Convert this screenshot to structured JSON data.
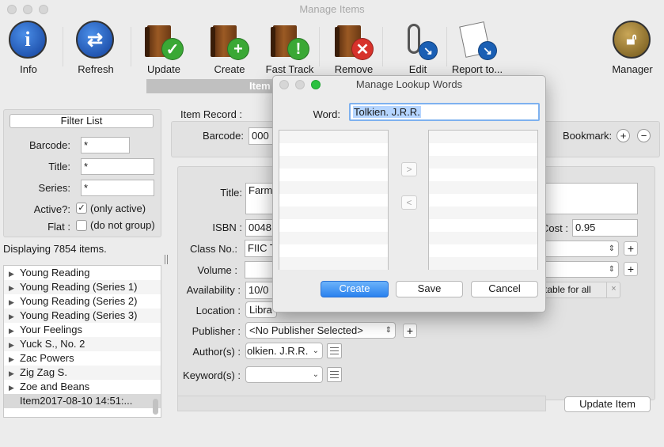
{
  "window": {
    "title": "Manage Items"
  },
  "toolbar": {
    "info": "Info",
    "refresh": "Refresh",
    "update": "Update",
    "create": "Create",
    "fast_track": "Fast Track",
    "remove": "Remove",
    "edit": "Edit",
    "report": "Report to...",
    "manager": "Manager"
  },
  "tab": {
    "label": "Item"
  },
  "filter": {
    "button": "Filter List",
    "barcode_label": "Barcode:",
    "barcode_value": "*",
    "title_label": "Title:",
    "title_value": "*",
    "series_label": "Series:",
    "series_value": "*",
    "active_label": "Active?:",
    "active_option": "(only active)",
    "active_checked": true,
    "flat_label": "Flat :",
    "flat_option": "(do not group)"
  },
  "list": {
    "status": "Displaying 7854 items.",
    "items": [
      "Young Reading",
      "Young Reading (Series 1)",
      "Young Reading (Series 2)",
      "Young Reading (Series 3)",
      "Your Feelings",
      "Yuck S., No. 2",
      "Zac Powers",
      "Zig Zag S.",
      "Zoe and Beans"
    ],
    "selected_item": "Item2017-08-10 14:51:..."
  },
  "record": {
    "header": "Item Record :",
    "barcode_label": "Barcode:",
    "barcode_value": "000",
    "bookmark_label": "Bookmark:",
    "title_label": "Title:",
    "title_value": "Farm",
    "isbn_label": "ISBN :",
    "isbn_value": "0048",
    "cost_label": "Cost :",
    "cost_value": "0.95",
    "class_label": "Class No.:",
    "class_value": "FIIC T",
    "volume_label": "Volume :",
    "availability_label": "Availability :",
    "availability_value": "10/0",
    "suitable_text": "table for all",
    "location_label": "Location :",
    "location_value": "Libra",
    "publisher_label": "Publisher :",
    "publisher_value": "<No Publisher Selected>",
    "author_label": "Author(s) :",
    "author_value": "olkien. J.R.R.",
    "keyword_label": "Keyword(s) :",
    "update_button": "Update Item"
  },
  "dialog": {
    "title": "Manage Lookup Words",
    "word_label": "Word:",
    "word_value": "Tolkien. J.R.R.",
    "add_arrow": ">",
    "remove_arrow": "<",
    "create": "Create",
    "save": "Save",
    "cancel": "Cancel"
  },
  "colors": {
    "accent": "#3b8ef0",
    "selection": "#b5d5ff",
    "info_blue": "#1a5fb4",
    "green": "#3aa835",
    "red": "#d7322b"
  }
}
